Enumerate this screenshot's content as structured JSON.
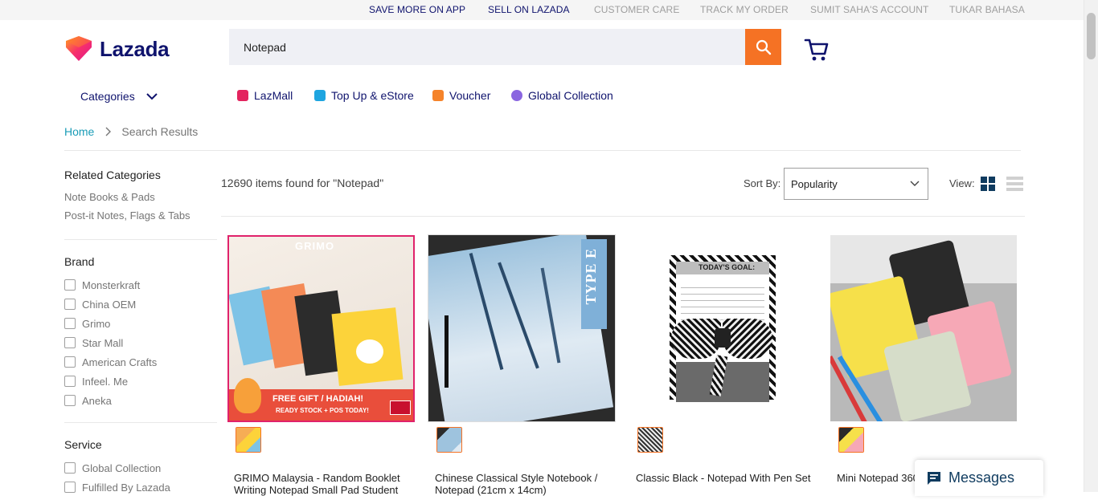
{
  "topbar": {
    "links": [
      "SAVE MORE ON APP",
      "SELL ON LAZADA",
      "CUSTOMER CARE",
      "TRACK MY ORDER",
      "SUMIT SAHA'S ACCOUNT",
      "TUKAR BAHASA"
    ]
  },
  "header": {
    "logo_text": "Lazada",
    "search_value": "Notepad",
    "search_icon": "search-icon",
    "cart_icon": "cart-icon"
  },
  "nav": {
    "categories_label": "Categories",
    "items": [
      "LazMall",
      "Top Up & eStore",
      "Voucher",
      "Global Collection"
    ]
  },
  "breadcrumb": {
    "home": "Home",
    "current": "Search Results"
  },
  "sidebar": {
    "related_title": "Related Categories",
    "related": [
      "Note Books & Pads",
      "Post-it Notes, Flags & Tabs"
    ],
    "brand_title": "Brand",
    "brands": [
      "Monsterkraft",
      "China OEM",
      "Grimo",
      "Star Mall",
      "American Crafts",
      "Infeel. Me",
      "Aneka"
    ],
    "service_title": "Service",
    "services": [
      "Global Collection",
      "Fulfilled By Lazada"
    ]
  },
  "results": {
    "count_text": "12690 items found for \"Notepad\"",
    "sort_label": "Sort By:",
    "sort_value": "Popularity",
    "view_label": "View:"
  },
  "products": [
    {
      "title": "GRIMO Malaysia - Random Booklet Writing Notepad Small Pad Student",
      "img_text_brand": "GRIMO",
      "img_text_banner": "FREE GIFT / HADIAH!",
      "img_text_banner2": "READY STOCK + POS TODAY!"
    },
    {
      "title": "Chinese Classical Style Notebook / Notepad (21cm x 14cm)",
      "img_text_tag": "TYPE E"
    },
    {
      "title": "Classic Black - Notepad With Pen Set",
      "img_text_goal": "TODAY'S GOAL:"
    },
    {
      "title": "Mini Notepad 360 For Student and O"
    }
  ],
  "messages": {
    "label": "Messages"
  },
  "colors": {
    "accent": "#f57224",
    "navy": "#0f136d",
    "link_blue": "#1a9cb7"
  }
}
